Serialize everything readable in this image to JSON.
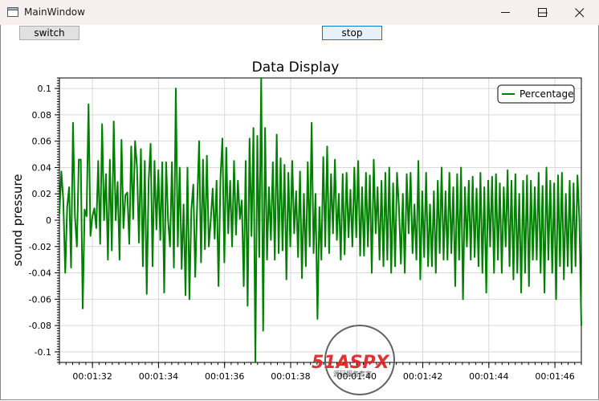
{
  "window": {
    "title": "MainWindow",
    "controls": [
      "minimize-icon",
      "maximize-icon",
      "close-icon"
    ]
  },
  "toolbar": {
    "switch_label": "switch",
    "stop_label": "stop"
  },
  "watermark": {
    "brand": "51ASPX",
    "tagline": "源码服务专家"
  },
  "chart_data": {
    "type": "line",
    "title": "Data Display",
    "xlabel": "",
    "ylabel": "sound pressure",
    "x_start": "00:01:31.0",
    "x_end": "00:01:46.8",
    "xlim": [
      "00:01:31.0",
      "00:01:46.8"
    ],
    "x_ticks": [
      "00:01:32",
      "00:01:34",
      "00:01:36",
      "00:01:38",
      "00:01:40",
      "00:01:42",
      "00:01:44",
      "00:01:46"
    ],
    "ylim": [
      -0.108,
      0.108
    ],
    "y_ticks": [
      0.1,
      0.08,
      0.06,
      0.04,
      0.02,
      0,
      -0.02,
      -0.04,
      -0.06,
      -0.08,
      -0.1
    ],
    "grid": true,
    "legend_position": "top-right",
    "colors": {
      "series": "#008000",
      "grid": "#d9d9d9"
    },
    "series": [
      {
        "name": "Percentage",
        "values": [
          0.005,
          0.037,
          0.015,
          -0.04,
          0.01,
          0.025,
          -0.036,
          0.074,
          0.003,
          -0.02,
          0.046,
          0.046,
          -0.067,
          0.008,
          0.003,
          0.088,
          -0.012,
          0.003,
          0.009,
          -0.006,
          0.045,
          -0.018,
          0.073,
          0.0,
          0.035,
          -0.03,
          0.046,
          -0.023,
          0.075,
          0.0,
          0.029,
          -0.03,
          0.061,
          -0.006,
          0.019,
          0.021,
          -0.018,
          0.056,
          0.001,
          0.06,
          0.04,
          -0.017,
          0.054,
          -0.035,
          0.045,
          -0.056,
          0.03,
          0.058,
          -0.035,
          0.045,
          -0.007,
          0.038,
          -0.015,
          0.044,
          -0.055,
          0.044,
          0.0,
          -0.02,
          0.044,
          -0.036,
          0.1,
          -0.02,
          0.04,
          -0.037,
          0.012,
          -0.057,
          0.04,
          -0.06,
          0.008,
          0.027,
          -0.043,
          0.012,
          0.06,
          -0.032,
          0.046,
          -0.022,
          0.049,
          -0.02,
          0.0,
          0.024,
          -0.014,
          0.03,
          -0.05,
          0.032,
          0.062,
          -0.032,
          0.055,
          -0.01,
          0.03,
          -0.02,
          0.045,
          -0.011,
          0.03,
          0.001,
          0.015,
          -0.05,
          0.045,
          -0.065,
          0.062,
          -0.012,
          0.07,
          -0.108,
          0.064,
          -0.028,
          0.108,
          -0.084,
          0.07,
          -0.03,
          0.025,
          -0.015,
          0.044,
          -0.03,
          0.065,
          -0.025,
          0.047,
          -0.023,
          0.042,
          -0.045,
          0.036,
          -0.02,
          0.045,
          -0.01,
          0.022,
          -0.028,
          0.037,
          -0.044,
          0.02,
          -0.035,
          0.044,
          -0.02,
          0.074,
          -0.025,
          0.02,
          -0.075,
          0.01,
          -0.03,
          0.048,
          -0.02,
          0.056,
          -0.025,
          0.035,
          -0.01,
          0.046,
          -0.015,
          0.02,
          -0.03,
          0.035,
          -0.026,
          0.036,
          -0.013,
          0.023,
          -0.02,
          0.04,
          -0.013,
          0.045,
          -0.027,
          0.025,
          -0.027,
          0.036,
          -0.02,
          0.034,
          -0.04,
          0.046,
          -0.01,
          0.025,
          -0.03,
          0.03,
          -0.035,
          0.036,
          -0.03,
          0.04,
          -0.04,
          0.028,
          -0.035,
          0.036,
          0.01,
          -0.033,
          0.02,
          -0.04,
          0.035,
          -0.01,
          0.036,
          -0.025,
          0.012,
          -0.03,
          0.045,
          -0.045,
          0.022,
          -0.028,
          0.036,
          -0.035,
          0.012,
          -0.035,
          0.022,
          -0.04,
          0.03,
          -0.025,
          0.04,
          -0.03,
          0.022,
          -0.03,
          0.036,
          -0.025,
          0.025,
          -0.05,
          0.035,
          -0.03,
          0.04,
          -0.06,
          0.025,
          -0.02,
          0.03,
          -0.03,
          0.033,
          -0.028,
          0.024,
          -0.035,
          0.036,
          -0.04,
          0.025,
          -0.055,
          0.03,
          -0.02,
          0.033,
          -0.04,
          0.035,
          -0.03,
          0.028,
          -0.04,
          0.025,
          -0.02,
          0.038,
          -0.035,
          0.03,
          -0.045,
          0.035,
          -0.04,
          0.02,
          -0.055,
          0.03,
          -0.04,
          0.034,
          -0.05,
          0.03,
          -0.03,
          0.025,
          -0.03,
          0.036,
          -0.04,
          0.026,
          -0.055,
          0.04,
          -0.03,
          0.03,
          -0.04,
          0.028,
          -0.06,
          0.034,
          -0.035,
          0.036,
          -0.045,
          0.02,
          -0.035,
          0.03,
          -0.04,
          0.028,
          -0.035,
          0.034,
          0.0,
          -0.08
        ]
      }
    ]
  }
}
